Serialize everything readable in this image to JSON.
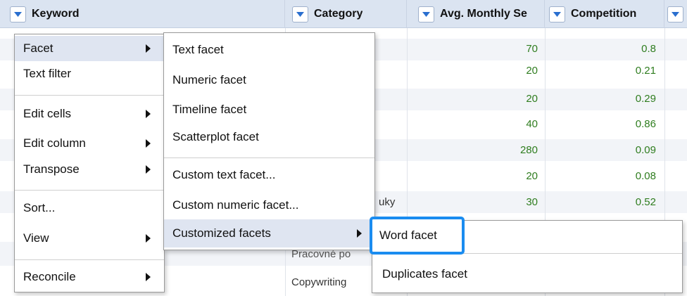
{
  "columns": {
    "keyword": "Keyword",
    "category": "Category",
    "avg_monthly": "Avg. Monthly Se",
    "competition": "Competition"
  },
  "rows": [
    {
      "category": "",
      "avg": "70",
      "comp": "0.8"
    },
    {
      "category": "",
      "avg": "20",
      "comp": "0.21"
    },
    {
      "category": "",
      "avg": "20",
      "comp": "0.29"
    },
    {
      "category": "",
      "avg": "40",
      "comp": "0.86"
    },
    {
      "category": "",
      "avg": "280",
      "comp": "0.09"
    },
    {
      "category": "",
      "avg": "20",
      "comp": "0.08"
    },
    {
      "category": "uky",
      "avg": "30",
      "comp": "0.52"
    },
    {
      "category": "",
      "avg": "",
      "comp": ""
    },
    {
      "category": "Pracovné po",
      "avg": "",
      "comp": ""
    },
    {
      "category": "Copywriting",
      "avg": "",
      "comp": ""
    }
  ],
  "column_menu": {
    "facet": "Facet",
    "text_filter": "Text filter",
    "edit_cells": "Edit cells",
    "edit_column": "Edit column",
    "transpose": "Transpose",
    "sort": "Sort...",
    "view": "View",
    "reconcile": "Reconcile"
  },
  "facet_menu": {
    "text_facet": "Text facet",
    "numeric_facet": "Numeric facet",
    "timeline_facet": "Timeline facet",
    "scatterplot_facet": "Scatterplot facet",
    "custom_text_facet": "Custom text facet...",
    "custom_numeric_facet": "Custom numeric facet...",
    "customized_facets": "Customized facets"
  },
  "customized_menu": {
    "word_facet": "Word facet",
    "duplicates_facet": "Duplicates facet"
  },
  "colors": {
    "header_bg": "#dbe4f1",
    "value_green": "#2f7d1f",
    "highlight": "#1a8cf0"
  },
  "icons": {
    "column_dropdown": "triangle-down-icon",
    "submenu": "triangle-right-icon"
  }
}
